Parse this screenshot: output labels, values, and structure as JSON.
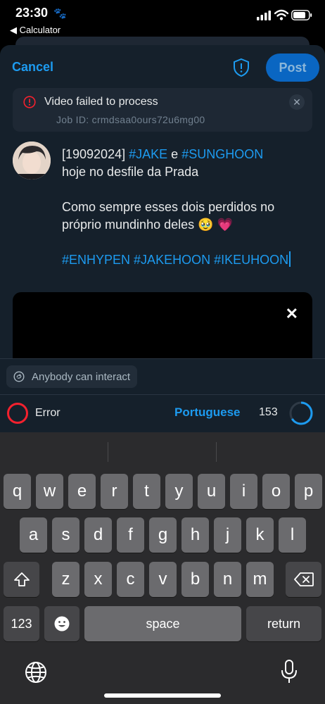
{
  "status_bar": {
    "time": "23:30",
    "back_app": "Calculator"
  },
  "header": {
    "cancel_label": "Cancel",
    "post_label": "Post"
  },
  "error_banner": {
    "title": "Video failed to process",
    "job_id": "Job ID: crmdsaa0ours72u6mg00"
  },
  "tweet": {
    "date": "[19092024]",
    "tag_jake": "#JAKE",
    "connector": "e",
    "tag_sunghoon": "#SUNGHOON",
    "line2": "hoje no desfile da Prada",
    "line3a": "Como sempre esses dois perdidos no",
    "line3b": "próprio mundinho deles",
    "emoji": "🥹 💗",
    "hashtags": [
      "#ENHYPEN",
      "#JAKEHOON",
      "#IKEUHOON"
    ]
  },
  "video": {
    "close_glyph": "✕"
  },
  "reply_setting": {
    "label": "Anybody can interact"
  },
  "footer": {
    "error_label": "Error",
    "language": "Portuguese",
    "char_count": "153",
    "char_progress": 0.66
  },
  "keyboard": {
    "row1": [
      "q",
      "w",
      "e",
      "r",
      "t",
      "y",
      "u",
      "i",
      "o",
      "p"
    ],
    "row2": [
      "a",
      "s",
      "d",
      "f",
      "g",
      "h",
      "j",
      "k",
      "l"
    ],
    "row3": [
      "z",
      "x",
      "c",
      "v",
      "b",
      "n",
      "m"
    ],
    "numbers_key": "123",
    "space_key": "space",
    "return_key": "return"
  },
  "colors": {
    "accent": "#1d9bf0",
    "error": "#f4212e",
    "background": "#15202b"
  }
}
